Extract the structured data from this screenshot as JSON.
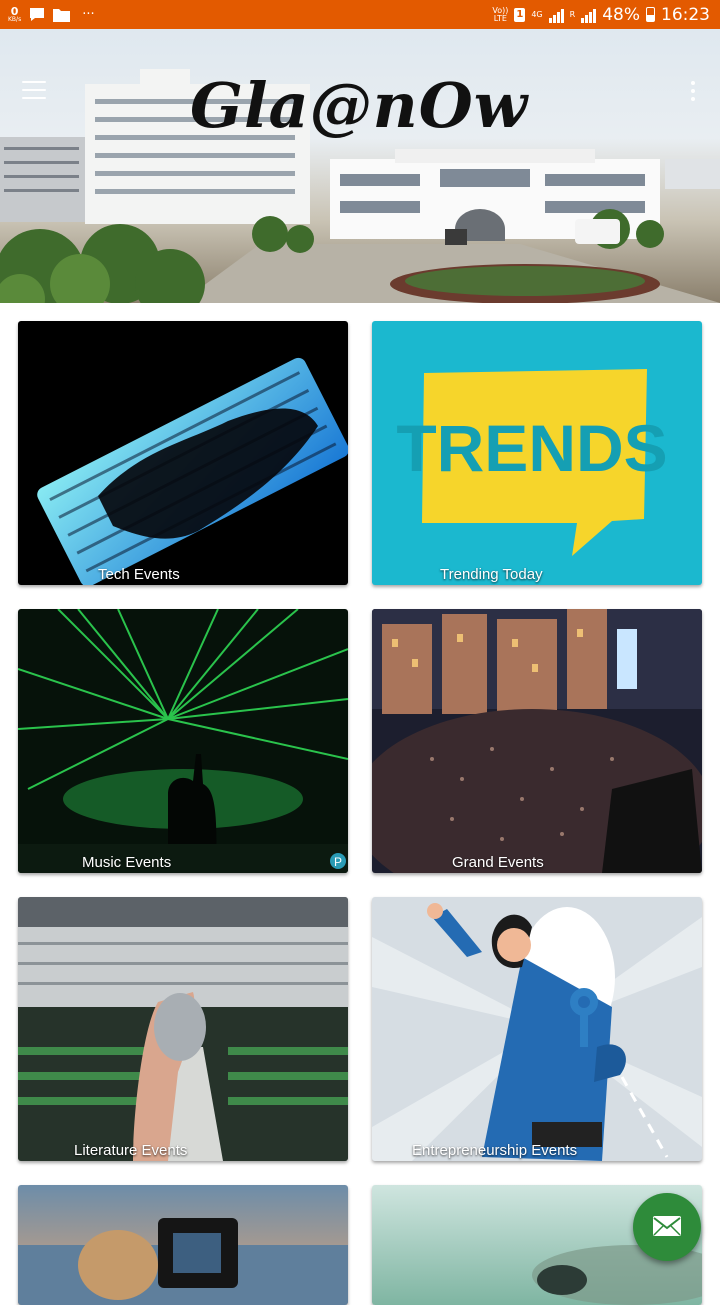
{
  "status_bar": {
    "speed_value": "0",
    "speed_unit": "KB/s",
    "more": "···",
    "volte_top": "Vo))",
    "volte_bottom": "LTE",
    "sim": "1",
    "network": "4G",
    "signal_top": "R",
    "battery_percent": "48%",
    "time": "16:23"
  },
  "header": {
    "logo_text": "Gla@nOw"
  },
  "categories": [
    {
      "label": "Tech Events"
    },
    {
      "label": "Trending Today"
    },
    {
      "label": "Music Events"
    },
    {
      "label": "Grand Events"
    },
    {
      "label": "Literature Events"
    },
    {
      "label": "Entrepreneurship Events"
    }
  ],
  "trends_sign": "TRENDS",
  "music_badge": "P",
  "colors": {
    "status_bar": "#e35a00",
    "fab": "#2e8b3a"
  }
}
